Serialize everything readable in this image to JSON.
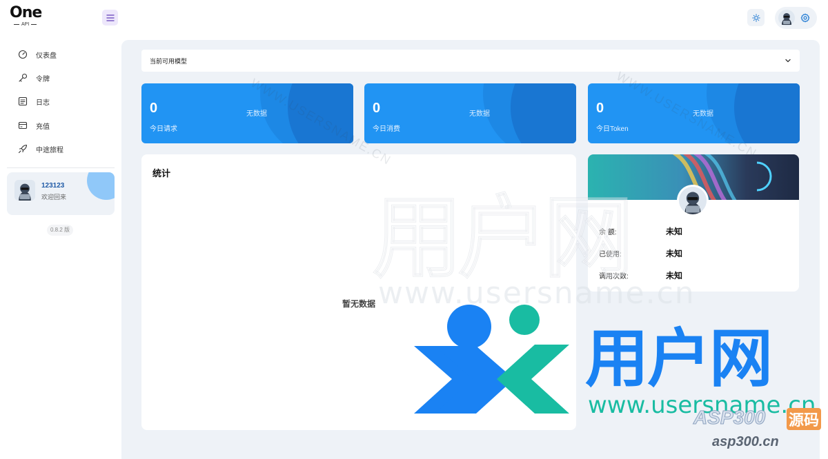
{
  "brand": {
    "logo_text": "One",
    "logo_sub": "API"
  },
  "nav": {
    "items": [
      {
        "label": "仪表盘",
        "icon": "dashboard-icon"
      },
      {
        "label": "令牌",
        "icon": "key-icon"
      },
      {
        "label": "日志",
        "icon": "log-icon"
      },
      {
        "label": "充值",
        "icon": "wallet-icon"
      },
      {
        "label": "中途旅程",
        "icon": "rocket-icon"
      }
    ]
  },
  "user_card": {
    "name": "123123",
    "welcome": "欢迎回来"
  },
  "version": "0.8.2 版",
  "model_select": {
    "label": "当前可用模型"
  },
  "stats": [
    {
      "value": "0",
      "label": "今日请求",
      "status": "无数据"
    },
    {
      "value": "0",
      "label": "今日消费",
      "status": "无数据"
    },
    {
      "value": "0",
      "label": "今日Token",
      "status": "无数据"
    }
  ],
  "chart": {
    "title": "统计",
    "empty_text": "暂无数据"
  },
  "profile": {
    "rows": [
      {
        "label": "余 额:",
        "value": "未知"
      },
      {
        "label": "已使用:",
        "value": "未知"
      },
      {
        "label": "调用次数:",
        "value": "未知"
      }
    ]
  },
  "watermark": {
    "cn": "用户网",
    "url": "www.usersname.cn",
    "asp_logo": "ASP300",
    "asp_badge": "源码",
    "asp_url": "asp300.cn",
    "diag": "WWW.USERSNAME.CN"
  },
  "colors": {
    "primary": "#2194f3",
    "accent": "#1976d2",
    "bg": "#eef2f7"
  }
}
